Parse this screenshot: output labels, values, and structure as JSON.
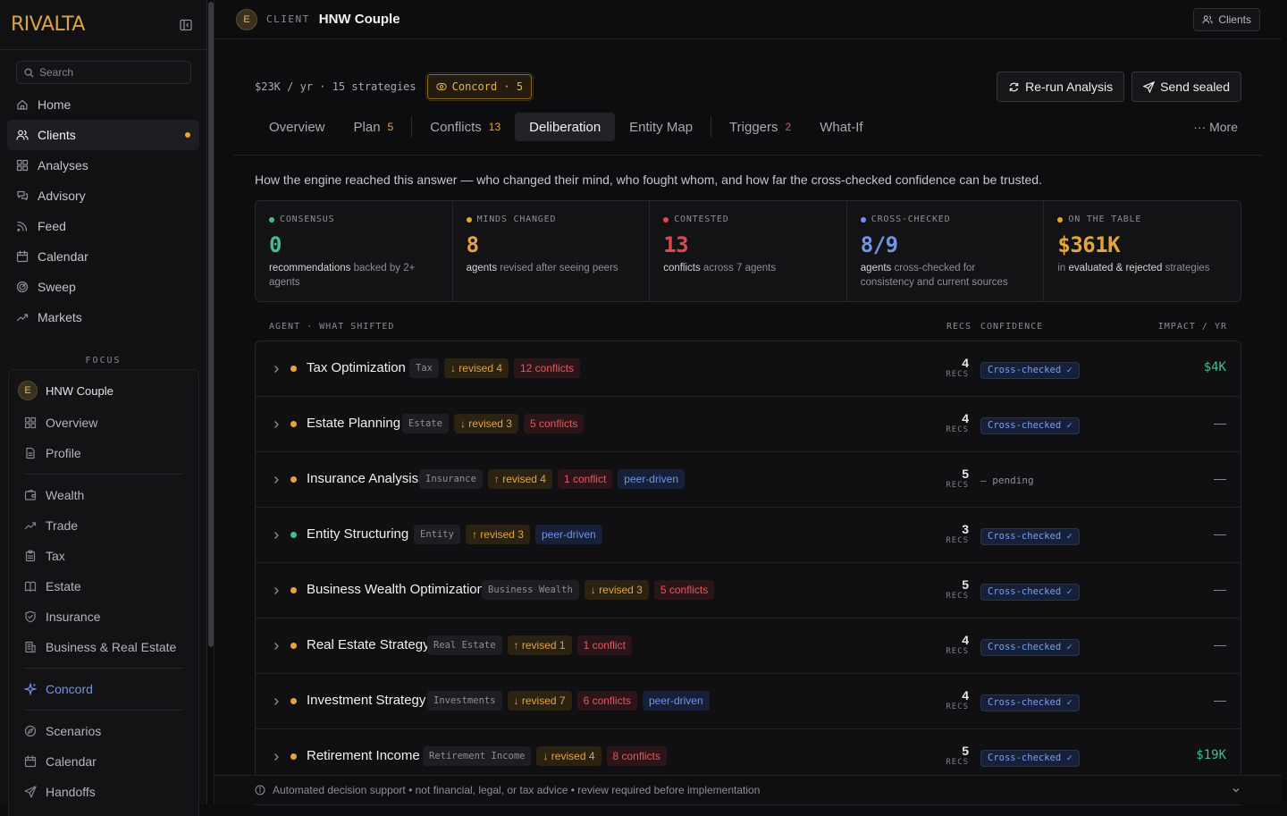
{
  "app": {
    "logo": "RIVALTA"
  },
  "sidebar": {
    "search_placeholder": "Search",
    "nav": [
      {
        "label": "Home",
        "icon": "home-icon"
      },
      {
        "label": "Clients",
        "icon": "users-icon",
        "active": true,
        "dot": true
      },
      {
        "label": "Analyses",
        "icon": "grid-icon"
      },
      {
        "label": "Advisory",
        "icon": "chat-icon"
      },
      {
        "label": "Feed",
        "icon": "rss-icon"
      },
      {
        "label": "Calendar",
        "icon": "calendar-icon"
      },
      {
        "label": "Sweep",
        "icon": "radar-icon"
      },
      {
        "label": "Markets",
        "icon": "trend-icon"
      }
    ],
    "focus_label": "FOCUS",
    "focus_client": {
      "initial": "E",
      "name": "HNW Couple"
    },
    "focus_items_a": [
      {
        "label": "Overview",
        "icon": "grid-icon"
      },
      {
        "label": "Profile",
        "icon": "document-icon"
      }
    ],
    "focus_items_b": [
      {
        "label": "Wealth",
        "icon": "wallet-icon"
      },
      {
        "label": "Trade",
        "icon": "trend-icon"
      },
      {
        "label": "Tax",
        "icon": "clipboard-icon"
      },
      {
        "label": "Estate",
        "icon": "book-icon"
      },
      {
        "label": "Insurance",
        "icon": "shield-icon"
      },
      {
        "label": "Business & Real Estate",
        "icon": "building-icon"
      }
    ],
    "concord_label": "Concord",
    "focus_items_c": [
      {
        "label": "Scenarios",
        "icon": "compass-icon"
      },
      {
        "label": "Calendar",
        "icon": "calendar-icon"
      },
      {
        "label": "Handoffs",
        "icon": "send-icon"
      }
    ]
  },
  "topbar": {
    "initial": "E",
    "client_kw": "CLIENT",
    "client_name": "HNW Couple",
    "clients_btn": "Clients"
  },
  "header": {
    "stats": "$23K / yr · 15 strategies",
    "concord_chip": "Concord · 5",
    "rerun": "Re-run Analysis",
    "send": "Send sealed"
  },
  "tabs": [
    {
      "label": "Overview",
      "count": ""
    },
    {
      "label": "Plan",
      "count": "5",
      "count_color": "amber"
    },
    {
      "label": "Conflicts",
      "count": "13",
      "count_color": "amber"
    },
    {
      "label": "Deliberation",
      "count": "",
      "active": true
    },
    {
      "label": "Entity Map",
      "count": ""
    },
    {
      "label": "Triggers",
      "count": "2",
      "count_color": "red"
    },
    {
      "label": "What-If",
      "count": ""
    }
  ],
  "more_label": "··· More",
  "intro": "How the engine reached this answer — who changed their mind, who fought whom, and how far the cross-checked confidence can be trusted.",
  "kpis": [
    {
      "label": "CONSENSUS",
      "color": "#3fbf8a",
      "value": "0",
      "desc_bold": "recommendations",
      "desc": " backed by 2+ agents"
    },
    {
      "label": "MINDS CHANGED",
      "color": "#e7a437",
      "value": "8",
      "desc_bold": "agents",
      "desc": " revised after seeing peers"
    },
    {
      "label": "CONTESTED",
      "color": "#e0484f",
      "value": "13",
      "desc_bold": "conflicts",
      "desc": " across 7 agents"
    },
    {
      "label": "CROSS-CHECKED",
      "color": "#6e95e8",
      "value": "8/9",
      "desc_bold": "agents",
      "desc": " cross-checked for consistency and current sources"
    },
    {
      "label": "ON THE TABLE",
      "color": "#e7a437",
      "value": "$361K",
      "desc_pre": "in ",
      "desc_bold": "evaluated & rejected",
      "desc": " strategies"
    }
  ],
  "table": {
    "col_agent": "AGENT · WHAT SHIFTED",
    "col_recs": "RECS",
    "col_conf": "CONFIDENCE",
    "col_impact": "IMPACT / YR",
    "recs_unit": "RECS",
    "rows": [
      {
        "name": "Tax Optimization",
        "status": "#e7a437",
        "cat": "Tax",
        "rev": "↓ revised 4",
        "conflicts": "12 conflicts",
        "peer": "",
        "recs": "4",
        "confidence": "Cross-checked ✓",
        "impact": "$4K"
      },
      {
        "name": "Estate Planning",
        "status": "#e7a437",
        "cat": "Estate",
        "rev": "↓ revised 3",
        "conflicts": "5 conflicts",
        "peer": "",
        "recs": "4",
        "confidence": "Cross-checked ✓",
        "impact": "—"
      },
      {
        "name": "Insurance Analysis",
        "status": "#e7a437",
        "cat": "Insurance",
        "rev": "↑ revised 4",
        "conflicts": "1 conflict",
        "peer": "peer-driven",
        "recs": "5",
        "confidence": "— pending",
        "impact": "—"
      },
      {
        "name": "Entity Structuring",
        "status": "#3fbf8a",
        "cat": "Entity",
        "rev": "↑ revised 3",
        "conflicts": "",
        "peer": "peer-driven",
        "recs": "3",
        "confidence": "Cross-checked ✓",
        "impact": "—"
      },
      {
        "name": "Business Wealth Optimization",
        "status": "#e7a437",
        "cat": "Business Wealth",
        "rev": "↓ revised 3",
        "conflicts": "5 conflicts",
        "peer": "",
        "recs": "5",
        "confidence": "Cross-checked ✓",
        "impact": "—"
      },
      {
        "name": "Real Estate Strategy",
        "status": "#e7a437",
        "cat": "Real Estate",
        "rev": "↑ revised 1",
        "conflicts": "1 conflict",
        "peer": "",
        "recs": "4",
        "confidence": "Cross-checked ✓",
        "impact": "—"
      },
      {
        "name": "Investment Strategy",
        "status": "#e7a437",
        "cat": "Investments",
        "rev": "↓ revised 7",
        "conflicts": "6 conflicts",
        "peer": "peer-driven",
        "recs": "4",
        "confidence": "Cross-checked ✓",
        "impact": "—"
      },
      {
        "name": "Retirement Income",
        "status": "#e7a437",
        "cat": "Retirement Income",
        "rev": "↓ revised 4",
        "conflicts": "8 conflicts",
        "peer": "",
        "recs": "5",
        "confidence": "Cross-checked ✓",
        "impact": "$19K"
      }
    ]
  },
  "footer": "Automated decision support • not financial, legal, or tax advice • review required before implementation"
}
